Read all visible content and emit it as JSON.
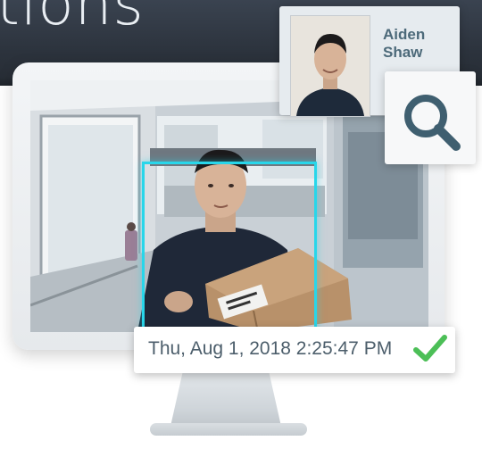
{
  "banner": {
    "text": "tions",
    "color": "#e9eef3"
  },
  "profile": {
    "name_line1": "Aiden",
    "name_line2": "Shaw"
  },
  "timestamp": {
    "text": "Thu, Aug 1, 2018 2:25:47 PM"
  },
  "icons": {
    "search": "search-icon",
    "verified": "checkmark-icon"
  },
  "colors": {
    "detection_box": "#28d6ea",
    "check": "#4cbf57",
    "name_text": "#4d6a7a"
  }
}
